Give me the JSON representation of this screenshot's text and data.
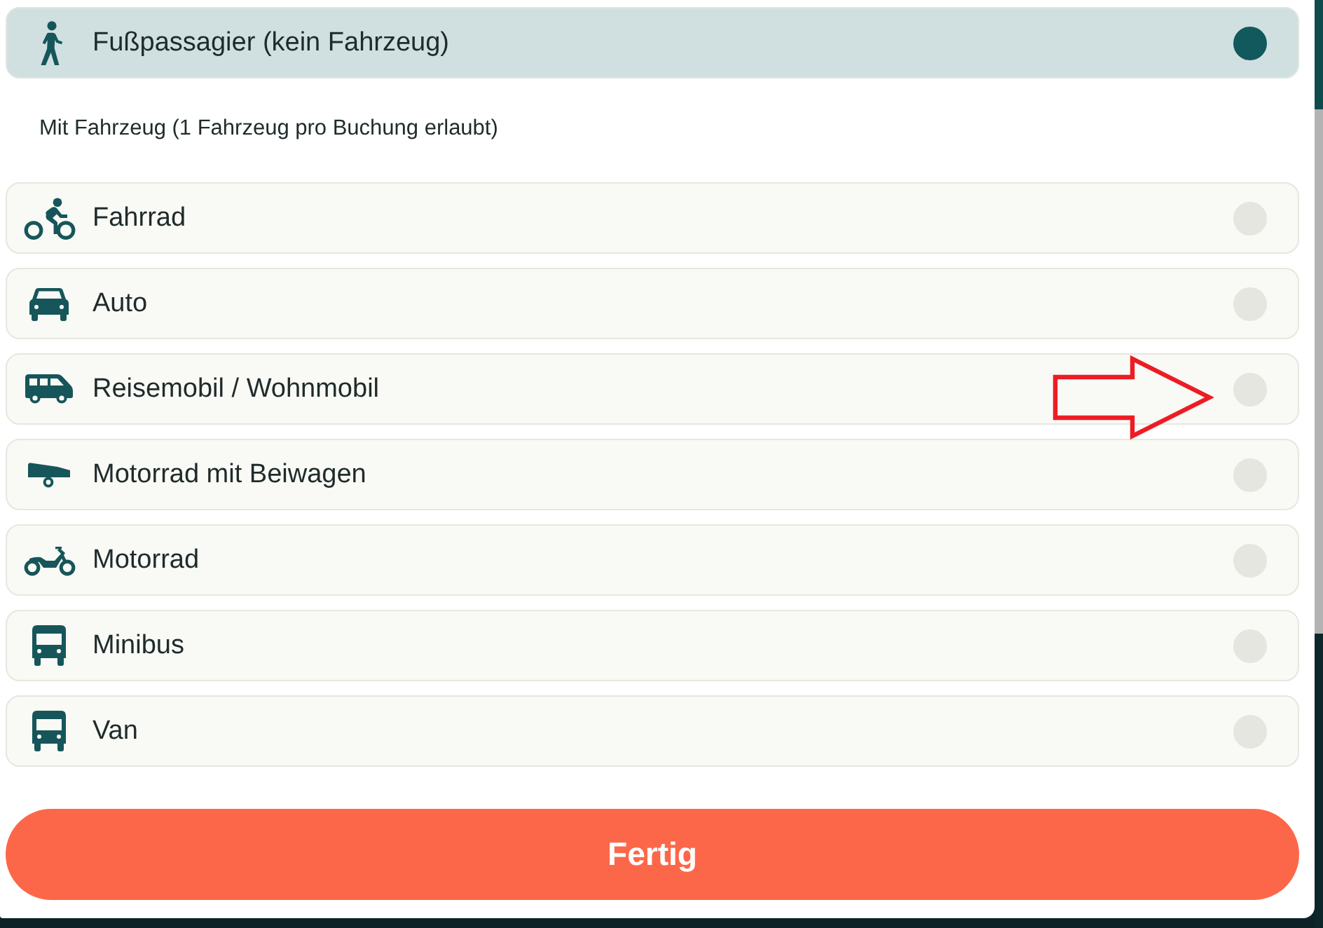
{
  "passenger_option": {
    "kind": "walk",
    "label": "Fußpassagier (kein Fahrzeug)",
    "selected": true
  },
  "vehicle_section": {
    "heading": "Mit Fahrzeug (1 Fahrzeug pro Buchung erlaubt)",
    "options": [
      {
        "kind": "bicycle",
        "label": "Fahrrad",
        "selected": false
      },
      {
        "kind": "car",
        "label": "Auto",
        "selected": false
      },
      {
        "kind": "camper",
        "label": "Reisemobil / Wohnmobil",
        "selected": false
      },
      {
        "kind": "sidecar",
        "label": "Motorrad mit Beiwagen",
        "selected": false
      },
      {
        "kind": "motorcycle",
        "label": "Motorrad",
        "selected": false
      },
      {
        "kind": "minibus",
        "label": "Minibus",
        "selected": false
      },
      {
        "kind": "van",
        "label": "Van",
        "selected": false
      }
    ]
  },
  "done_button": {
    "label": "Fertig"
  }
}
